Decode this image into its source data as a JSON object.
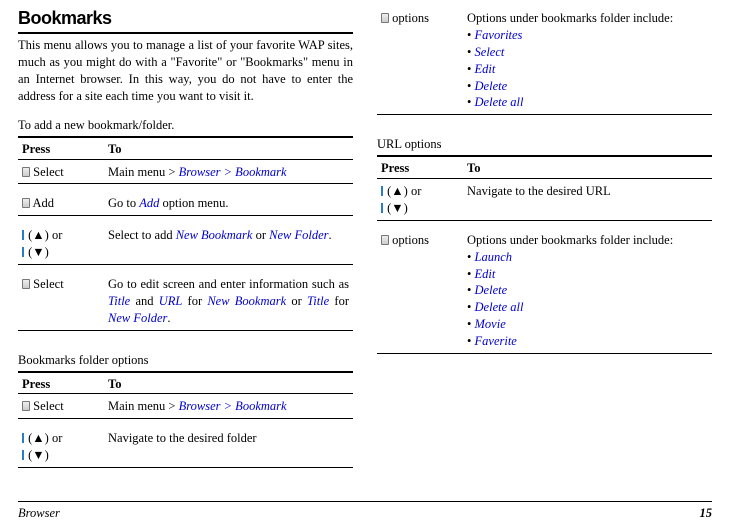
{
  "title": "Bookmarks",
  "intro": "This menu allows you to manage a list of your favorite WAP sites, much as you might do with a \"Favorite\" or \"Bookmarks\" menu in an Internet browser. In this way, you do not have to enter the address for a site each time you want to visit it.",
  "add_bookmark_caption": "To add a new bookmark/folder.",
  "headers": {
    "press": "Press",
    "to": "To"
  },
  "keys": {
    "select": "Select",
    "add": "Add",
    "options": "options",
    "up": "(▲)",
    "down": "(▼)",
    "or": "or"
  },
  "t1": {
    "r1_pre": "Main menu > ",
    "r1_link": "Browser > Bookmark",
    "r2_pre": "Go to ",
    "r2_link": "Add",
    "r2_post": " option menu.",
    "r3_pre": "Select to add ",
    "r3_l1": "New Bookmark",
    "r3_mid": " or ",
    "r3_l2": "New Folder",
    "r3_post": ".",
    "r4_pre": "Go to edit screen and enter informa­tion such as ",
    "r4_l1": "Title",
    "r4_m1": " and ",
    "r4_l2": "URL",
    "r4_m2": " for ",
    "r4_l3": "New Bookmark",
    "r4_m3": " or ",
    "r4_l4": "Title",
    "r4_m4": " for ",
    "r4_l5": "New Folder",
    "r4_post": "."
  },
  "folder_caption": "Bookmarks folder options",
  "t2": {
    "r1_pre": "Main menu > ",
    "r1_link": "Browser > Bookmark",
    "r2": "Navigate to the desired folder"
  },
  "col2": {
    "r1_pre": "Options under bookmarks folder include:",
    "r1_items": [
      "Favorites",
      "Select",
      "Edit",
      "Delete",
      "Delete all"
    ]
  },
  "url_caption": "URL options",
  "t3": {
    "r1": "Navigate to the desired URL",
    "r2_pre": "Options under bookmarks folder include:",
    "r2_items": [
      "Launch",
      "Edit",
      "Delete",
      "Delete all",
      "Movie",
      "Faverite"
    ]
  },
  "footer": {
    "section": "Browser",
    "page": "15"
  }
}
